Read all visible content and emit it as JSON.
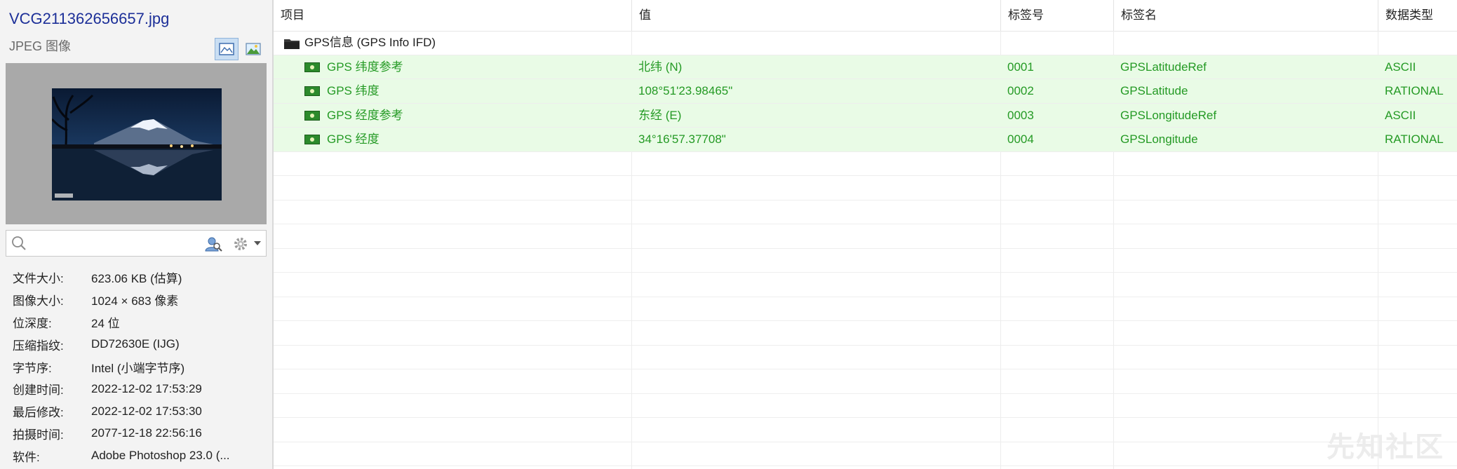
{
  "file": {
    "name": "VCG211362656657.jpg",
    "type": "JPEG 图像"
  },
  "view_buttons": [
    {
      "icon": "image-view-icon",
      "active": true
    },
    {
      "icon": "image-icon",
      "active": false
    }
  ],
  "preview": {
    "caption": "视觉中国"
  },
  "search": {
    "value": "",
    "placeholder": ""
  },
  "info": [
    {
      "label": "文件大小:",
      "value": "623.06 KB (估算)"
    },
    {
      "label": "图像大小:",
      "value": "1024 × 683 像素"
    },
    {
      "label": "位深度:",
      "value": "24 位"
    },
    {
      "label": "压缩指纹:",
      "value": "DD72630E (IJG)"
    },
    {
      "label": "字节序:",
      "value": "Intel (小端字节序)"
    },
    {
      "label": "创建时间:",
      "value": "2022-12-02 17:53:29"
    },
    {
      "label": "最后修改:",
      "value": "2022-12-02 17:53:30"
    },
    {
      "label": "拍摄时间:",
      "value": "2077-12-18 22:56:16"
    },
    {
      "label": "软件:",
      "value": "Adobe Photoshop 23.0 (..."
    }
  ],
  "table": {
    "headers": [
      "项目",
      "值",
      "标签号",
      "标签名",
      "数据类型"
    ],
    "group": {
      "icon": "folder-icon",
      "label": "GPS信息 (GPS Info IFD)"
    },
    "rows": [
      {
        "item": "GPS 纬度参考",
        "value": "北纬 (N)",
        "tag_no": "0001",
        "tag_name": "GPSLatitudeRef",
        "data_type": "ASCII"
      },
      {
        "item": "GPS 纬度",
        "value": "108°51'23.98465\"",
        "tag_no": "0002",
        "tag_name": "GPSLatitude",
        "data_type": "RATIONAL"
      },
      {
        "item": "GPS 经度参考",
        "value": "东经 (E)",
        "tag_no": "0003",
        "tag_name": "GPSLongitudeRef",
        "data_type": "ASCII"
      },
      {
        "item": "GPS 经度",
        "value": "34°16'57.37708\"",
        "tag_no": "0004",
        "tag_name": "GPSLongitude",
        "data_type": "RATIONAL"
      }
    ]
  },
  "watermark": "先知社区",
  "colors": {
    "accent_blue": "#1c2f98",
    "highlight_green_bg": "#e9fbe6",
    "green_text": "#249a24"
  }
}
